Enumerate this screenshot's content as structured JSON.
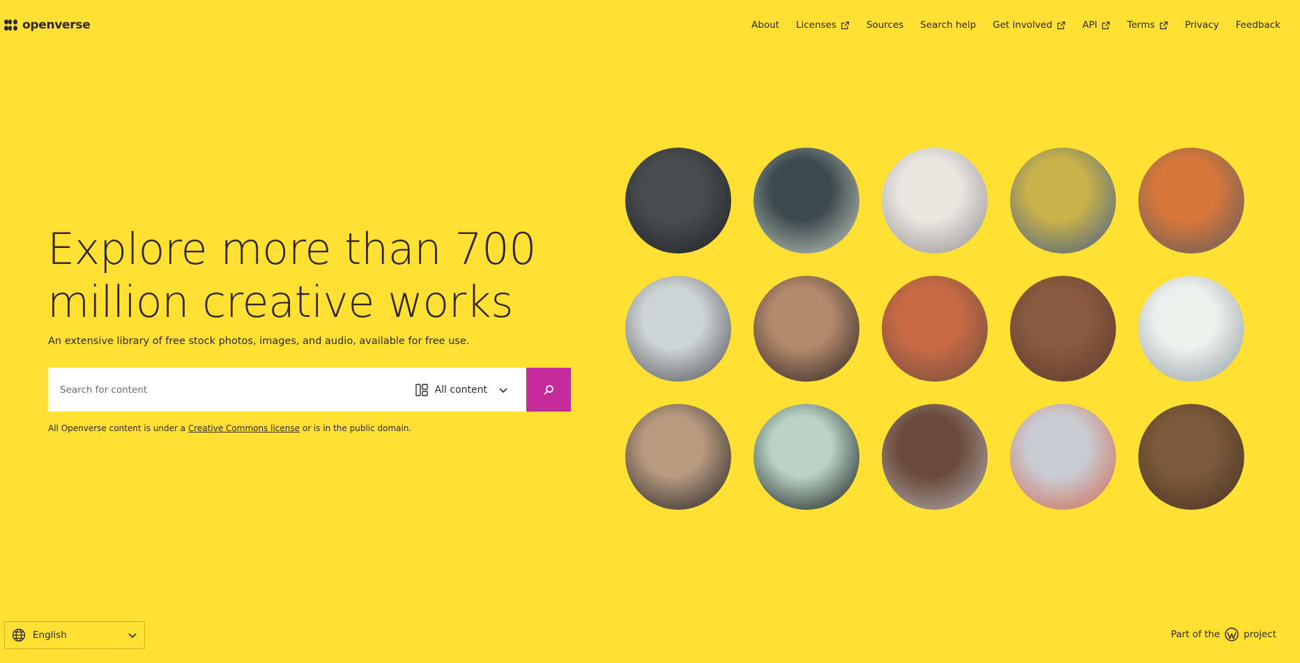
{
  "brand": {
    "name": "openverse"
  },
  "nav": [
    {
      "label": "About",
      "external": false
    },
    {
      "label": "Licenses",
      "external": true
    },
    {
      "label": "Sources",
      "external": false
    },
    {
      "label": "Search help",
      "external": false
    },
    {
      "label": "Get involved",
      "external": true
    },
    {
      "label": "API",
      "external": true
    },
    {
      "label": "Terms",
      "external": true
    },
    {
      "label": "Privacy",
      "external": false
    },
    {
      "label": "Feedback",
      "external": false
    }
  ],
  "hero": {
    "title_line1": "Explore more than 700",
    "title_line2": "million creative works",
    "subtitle": "An extensive library of free stock photos, images, and audio, available for free use."
  },
  "search": {
    "placeholder": "Search for content",
    "content_type": "All content"
  },
  "license_note": {
    "prefix": "All Openverse content is under a ",
    "link": "Creative Commons license",
    "suffix": " or is in the public domain."
  },
  "gallery": [
    {
      "name": "dark-bronze-vessel-image",
      "colors": [
        "#4a4d50",
        "#1e2124"
      ]
    },
    {
      "name": "celadon-bowl-image",
      "colors": [
        "#3d4a4e",
        "#c9d0c2"
      ]
    },
    {
      "name": "porcelain-figurine-image",
      "colors": [
        "#eae6e2",
        "#8e8c8e"
      ]
    },
    {
      "name": "glazed-tile-image",
      "colors": [
        "#c8b24a",
        "#3f5a8c"
      ]
    },
    {
      "name": "ceramic-animal-head-image",
      "colors": [
        "#d8773a",
        "#5c5c5e"
      ]
    },
    {
      "name": "white-dish-image",
      "colors": [
        "#cfd4d6",
        "#4a4b4d"
      ]
    },
    {
      "name": "clay-figure-image",
      "colors": [
        "#b48a6d",
        "#25211f"
      ]
    },
    {
      "name": "checkered-pot-image",
      "colors": [
        "#c96a45",
        "#6b4d3c"
      ]
    },
    {
      "name": "clay-face-image",
      "colors": [
        "#8a5a40",
        "#5a3a2a"
      ]
    },
    {
      "name": "painted-jar-image",
      "colors": [
        "#eef0ee",
        "#8e9a9c"
      ]
    },
    {
      "name": "carved-relief-image",
      "colors": [
        "#b89a80",
        "#1e1e20"
      ]
    },
    {
      "name": "celadon-vase-image",
      "colors": [
        "#b8d3c6",
        "#0e0f10"
      ]
    },
    {
      "name": "monkey-figure-image",
      "colors": [
        "#6a4a38",
        "#b5b3b7"
      ]
    },
    {
      "name": "floral-plate-image",
      "colors": [
        "#c9ccd3",
        "#d0654a"
      ]
    },
    {
      "name": "clay-mask-image",
      "colors": [
        "#7a5a3c",
        "#4a3220"
      ]
    }
  ],
  "footer": {
    "language": "English",
    "wp_prefix": "Part of the",
    "wp_suffix": "project"
  },
  "colors": {
    "background": "#ffe033",
    "text": "#30272e",
    "accent": "#c52b9b"
  }
}
